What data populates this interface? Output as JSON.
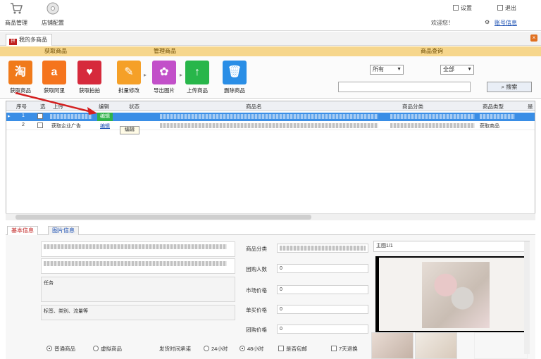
{
  "toolbar": {
    "buttons": [
      {
        "label": "商品管理",
        "icon": "cart-icon"
      },
      {
        "label": "店铺配置",
        "icon": "disc-icon"
      }
    ],
    "right": {
      "settings_label": "设置",
      "exit_label": "退出",
      "welcome_text": "欢迎您！",
      "user_link": "账号信息"
    }
  },
  "tabs": [
    {
      "label": "我的多商品"
    }
  ],
  "ribbon": {
    "groups": [
      "获取商品",
      "管理商品",
      "商品查询"
    ],
    "buttons": [
      {
        "label": "获取商品",
        "glyph": "淘",
        "color": "#f07a1a",
        "icon": "taobao-icon"
      },
      {
        "label": "获取阿里",
        "glyph": "a",
        "color": "#f5741d",
        "icon": "alibaba-icon"
      },
      {
        "label": "获取拍拍",
        "glyph": "♥",
        "color": "#d62a3c",
        "icon": "paipai-heart-icon"
      },
      {
        "label": "批量修改",
        "glyph": "✎",
        "color": "#f5a028",
        "icon": "pencil-icon"
      },
      {
        "label": "导出图片",
        "glyph": "✿",
        "color": "#c250c9",
        "icon": "image-export-icon"
      },
      {
        "label": "上传商品",
        "glyph": "↑",
        "color": "#28b64a",
        "icon": "upload-icon"
      },
      {
        "label": "删除商品",
        "glyph": "🗑",
        "color": "#2a8ee6",
        "icon": "trash-icon"
      }
    ],
    "filter1": "所有",
    "filter2": "全部",
    "search_placeholder": "",
    "search_button": "搜索"
  },
  "grid": {
    "headers": [
      "序号",
      "选",
      "上传",
      "编辑",
      "状态",
      "商品名",
      "商品分类",
      "商品类型",
      "是"
    ],
    "rows": [
      {
        "index": "1",
        "name_prefix": "",
        "edit": "编辑",
        "title": "",
        "category": "",
        "type": "",
        "selected": true
      },
      {
        "index": "2",
        "name_prefix": "获取企业广告",
        "edit": "编辑",
        "title": "",
        "category": "",
        "type": "获取商品",
        "selected": false
      }
    ],
    "tooltip": "编辑"
  },
  "bottom": {
    "tabs": [
      "基本信息",
      "图片信息"
    ],
    "description_hint": "任务",
    "tags_hint": "标签、类别、流量等",
    "fields": [
      {
        "label": "商品分类",
        "value": ""
      },
      {
        "label": "团购人数",
        "value": "0"
      },
      {
        "label": "市场价格",
        "value": "0"
      },
      {
        "label": "单买价格",
        "value": "0"
      },
      {
        "label": "团购价格",
        "value": "0"
      }
    ],
    "image_box_text": "主图1/1",
    "options": {
      "radio1": "普通商品",
      "radio2": "虚拟商品",
      "label_mid": "发货时间承诺",
      "radio3": "24小时",
      "radio4": "48小时",
      "check1": "是否包邮",
      "check2": "7天退换"
    }
  }
}
